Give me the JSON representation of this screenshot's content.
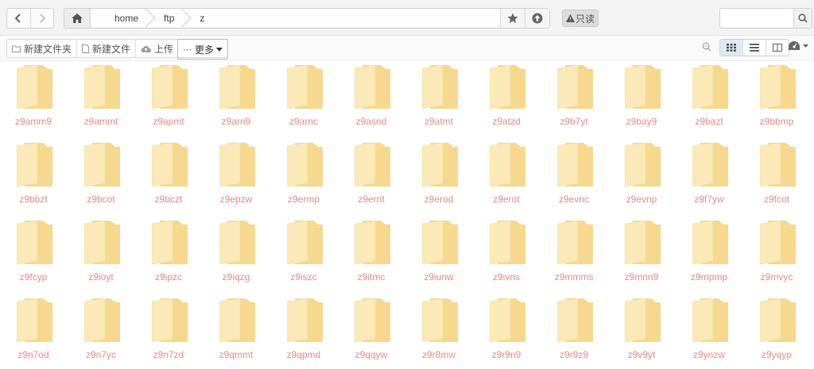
{
  "nav": {
    "back_icon": "chevron-left-icon",
    "forward_icon": "chevron-right-icon",
    "home_icon": "home-icon",
    "breadcrumbs": [
      "home",
      "ftp",
      "z"
    ],
    "bookmark_icon": "star-icon",
    "up_icon": "arrow-up-circle-icon",
    "readonly_label": "只读",
    "readonly_icon": "warning-icon",
    "search_placeholder": "",
    "search_icon": "search-icon"
  },
  "toolbar": {
    "new_folder": "新建文件夹",
    "new_file": "新建文件",
    "upload": "上传",
    "more": "更多",
    "view_modes": [
      "grid-view-icon",
      "list-view-icon",
      "column-view-icon"
    ],
    "active_view": "grid-view-icon"
  },
  "colors": {
    "folder_body": "#fbe9b7",
    "folder_back": "#f6d98e",
    "filename": "#e88c8c",
    "active_view_bg": "#dfe9f5"
  },
  "folders": [
    "z9amm9",
    "z9ammt",
    "z9apmt",
    "z9arn9",
    "z9arnc",
    "z9asnd",
    "z9atmt",
    "z9atzd",
    "z9b7yt",
    "z9bay9",
    "z9bazt",
    "z9bbmp",
    "z9bbzt",
    "z9bcot",
    "z9bczt",
    "z9epzw",
    "z9ermp",
    "z9ernt",
    "z9erod",
    "z9erot",
    "z9evnc",
    "z9evnp",
    "z9f7yw",
    "z9fcot",
    "z9fcyp",
    "z9ioyt",
    "z9ipzc",
    "z9iqzg",
    "z9iszc",
    "z9itmc",
    "z9iunw",
    "z9ivns",
    "z9mmms",
    "z9mnn9",
    "z9mpmp",
    "z9mvyc",
    "z9n7od",
    "z9n7yc",
    "z9n7zd",
    "z9qmmt",
    "z9qpmd",
    "z9qqyw",
    "z9r8mw",
    "z9r9n9",
    "z9r9z9",
    "z9v9yt",
    "z9ynzw",
    "z9yqyp"
  ]
}
